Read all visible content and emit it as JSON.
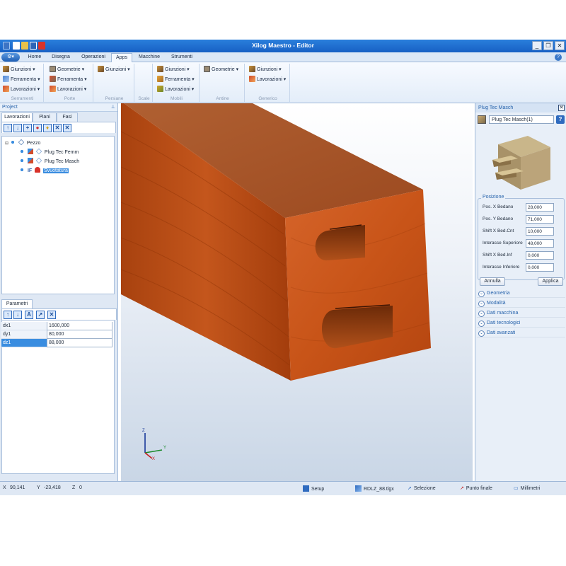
{
  "window": {
    "title": "Xilog Maestro - Editor",
    "controls": {
      "minimize": "_",
      "restore": "❐",
      "close": "✕"
    }
  },
  "ribbon": {
    "tabs": [
      "Home",
      "Disegna",
      "Operazioni",
      "Apps",
      "Macchine",
      "Strumenti"
    ],
    "active_tab": "Apps",
    "groups": [
      {
        "caption": "Serramenti",
        "items": [
          "Giunzioni",
          "Ferramenta",
          "Lavorazioni"
        ]
      },
      {
        "caption": "Porte",
        "items": [
          "Geometrie",
          "Ferramenta",
          "Lavorazioni"
        ]
      },
      {
        "caption": "Persiane",
        "items": [
          "Giunzioni"
        ]
      },
      {
        "caption": "Scale",
        "items": []
      },
      {
        "caption": "Mobili",
        "items": [
          "Giunzioni",
          "Ferramenta",
          "Lavorazioni"
        ]
      },
      {
        "caption": "Antine",
        "items": [
          "Geometrie"
        ]
      },
      {
        "caption": "Generico",
        "items": [
          "Giunzioni",
          "Lavorazioni"
        ]
      }
    ]
  },
  "project": {
    "title": "Project",
    "pin": "📌",
    "tabs": [
      "Lavorazioni",
      "Piani",
      "Fasi"
    ],
    "active_tab": "Lavorazioni",
    "tree": {
      "root": "Pezzo",
      "children": [
        {
          "label": "Plug Tec Femm",
          "prefix": ""
        },
        {
          "label": "Plug Tec Masch",
          "prefix": ""
        },
        {
          "label": "Svuotatura",
          "prefix": "IF",
          "selected": true
        }
      ]
    }
  },
  "parametri": {
    "tab": "Parametri",
    "rows": [
      {
        "key": "dx1",
        "value": "1600,000"
      },
      {
        "key": "dy1",
        "value": "80,000"
      },
      {
        "key": "dz1",
        "value": "88,000",
        "selected": true
      }
    ]
  },
  "properties": {
    "title": "Plug Tec Masch",
    "selector": "Plug Tec Masch(1)",
    "help": "?",
    "position_group": "Posizione",
    "fields": [
      {
        "label": "Pos. X Bedano",
        "value": "28,000"
      },
      {
        "label": "Pos. Y Bedano",
        "value": "71,000"
      },
      {
        "label": "Shift X Bed.Cnt",
        "value": "10,000"
      },
      {
        "label": "Interasse Superiore",
        "value": "48,000"
      },
      {
        "label": "Shift X Bed.Inf",
        "value": "0,000"
      },
      {
        "label": "Interasse Inferiore",
        "value": "0,000"
      }
    ],
    "buttons": {
      "cancel": "Annulla",
      "apply": "Applica"
    },
    "sections": [
      "Geometria",
      "Modalità",
      "Dati macchina",
      "Dati tecnologici",
      "Dati avanzati"
    ]
  },
  "axes": {
    "x": "X",
    "y": "Y",
    "z": "Z"
  },
  "statusbar": {
    "x_label": "X",
    "x_value": "90,141",
    "y_label": "Y",
    "y_value": "-23,418",
    "z_label": "Z",
    "z_value": "0",
    "setup": "Setup",
    "file": "RDLZ_88.tlgx",
    "selection": "Selezione",
    "endpoint": "Punto finale",
    "units": "Millimetri"
  },
  "colors": {
    "title_bar": "#1f6fd0",
    "wood_face": "#c8561c",
    "wood_side": "#b34a14",
    "wood_top": "#b45a2c",
    "selection": "#3a8de0"
  }
}
